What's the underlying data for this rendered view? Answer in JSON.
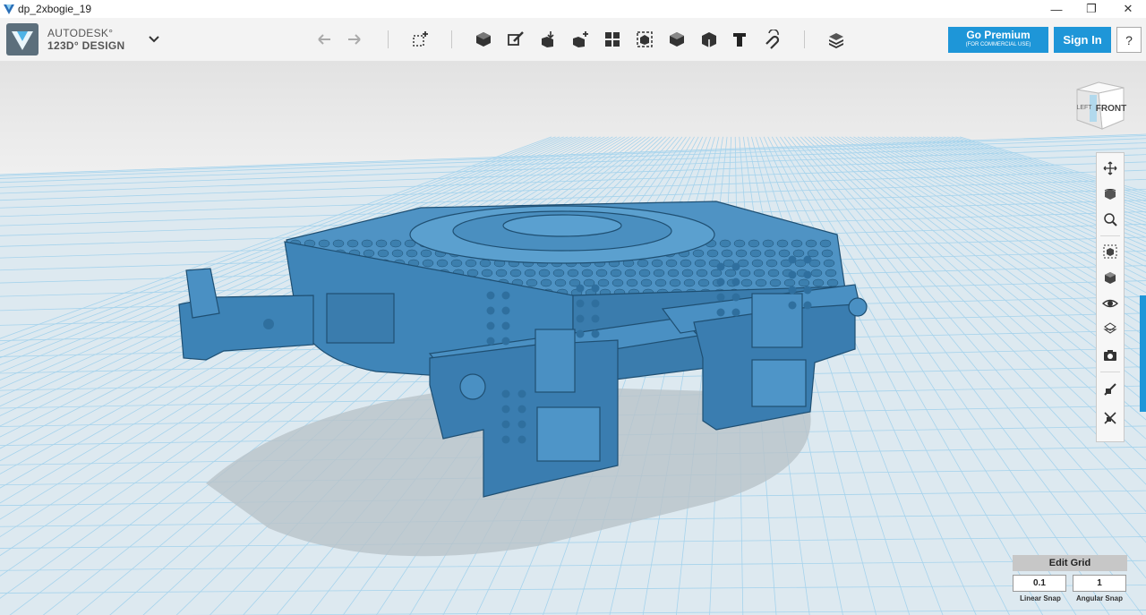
{
  "window": {
    "title": "dp_2xbogie_19",
    "minimize": "—",
    "maximize": "❐",
    "close": "✕"
  },
  "brand": {
    "line1": "AUTODESK°",
    "line2": "123D° DESIGN"
  },
  "toolbar": {
    "tools": [
      "undo-icon",
      "redo-icon",
      "transform-icon",
      "primitives-icon",
      "sketch-icon",
      "construct-icon",
      "modify-icon",
      "pattern-icon",
      "grouping-icon",
      "combine-icon",
      "measure-icon",
      "text-icon",
      "snap-icon",
      "material-icon"
    ]
  },
  "account": {
    "premium_label": "Go Premium",
    "premium_sub": "(FOR COMMERCIAL USE)",
    "signin_label": "Sign In",
    "help_label": "?"
  },
  "viewcube": {
    "front": "FRONT",
    "left": "LEFT"
  },
  "navbar": {
    "tools": [
      "pan-icon",
      "orbit-icon",
      "zoom-icon",
      "fit-icon",
      "views-icon",
      "visibility-icon",
      "materials-outline-icon",
      "screenshot-icon",
      "snap-on-icon",
      "snap-off-icon"
    ]
  },
  "grid": {
    "title": "Edit Grid",
    "linear_value": "0.1",
    "angular_value": "1",
    "linear_label": "Linear Snap",
    "angular_label": "Angular Snap"
  },
  "colors": {
    "accent": "#1e96d8",
    "model": "#3d7fae",
    "grid_line": "#8fc9e8"
  }
}
